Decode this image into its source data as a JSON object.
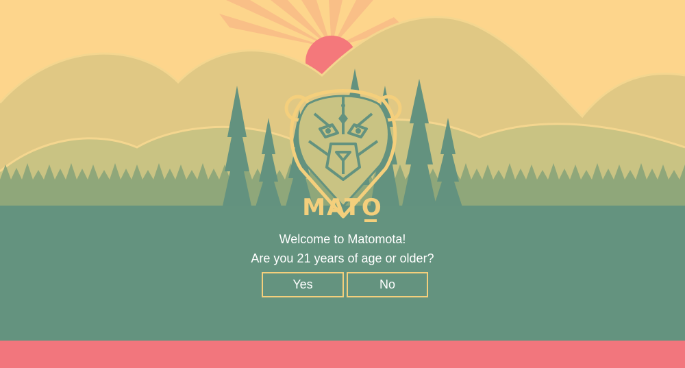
{
  "brand": {
    "name": "MATO"
  },
  "dialog": {
    "welcome_text": "Welcome to Matomota!",
    "question_text": "Are you 21 years of age or older?",
    "yes_label": "Yes",
    "no_label": "No"
  },
  "colors": {
    "sky": "#fdd58c",
    "sun": "#f4787b",
    "far_hills": "#e0c884",
    "near_hills": "#c9c383",
    "forest": "#63927f",
    "ground": "#64937f",
    "bottom_band": "#f2767d",
    "accent_gold": "#f4cf7c"
  },
  "icons": {
    "logo": "bear-head-icon"
  }
}
